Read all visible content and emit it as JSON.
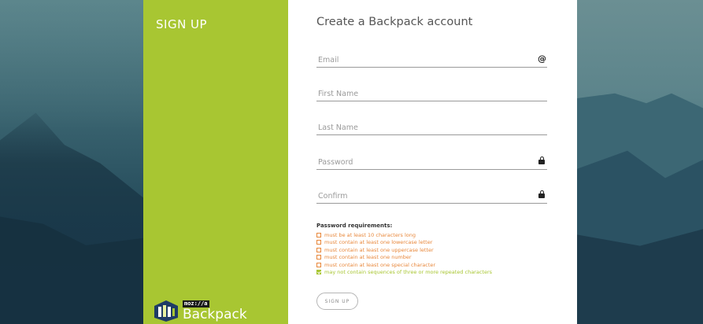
{
  "sidebar": {
    "title": "SIGN UP",
    "logo_moz": "moz://a",
    "logo_name": "Backpack"
  },
  "form": {
    "title": "Create a Backpack account",
    "fields": {
      "email": {
        "placeholder": "Email",
        "icon": "at-icon",
        "icon_glyph": "@"
      },
      "first_name": {
        "placeholder": "First Name"
      },
      "last_name": {
        "placeholder": "Last Name"
      },
      "password": {
        "placeholder": "Password",
        "icon": "lock-icon"
      },
      "confirm": {
        "placeholder": "Confirm",
        "icon": "lock-icon"
      }
    },
    "requirements": {
      "title": "Password requirements:",
      "items": [
        {
          "text": "must be at least 10 characters long",
          "met": false
        },
        {
          "text": "must contain at least one lowercase letter",
          "met": false
        },
        {
          "text": "must contain at least one uppercase letter",
          "met": false
        },
        {
          "text": "must contain at least one number",
          "met": false
        },
        {
          "text": "must contain at least one special character",
          "met": false
        },
        {
          "text": "may not contain sequences of three or more repeated characters",
          "met": true
        }
      ]
    },
    "submit_label": "SIGN UP"
  },
  "colors": {
    "accent_green": "#a8c632",
    "requirement_unmet": "#e8873a"
  }
}
